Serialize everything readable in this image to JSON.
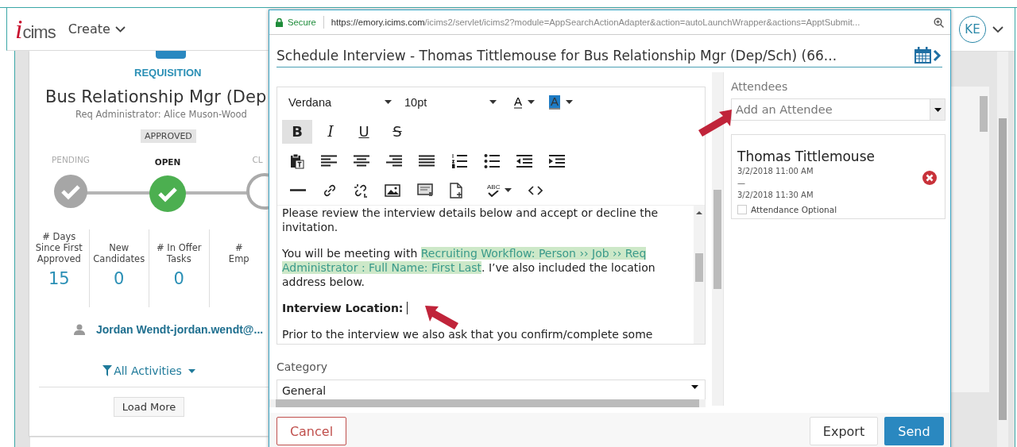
{
  "app_header": {
    "logo_mark": "i",
    "logo_word": "cims",
    "create_menu": "Create",
    "avatar": "KE"
  },
  "requisition": {
    "label": "REQUISITION",
    "title": "Bus Relationship Mgr (Dep",
    "administrator": "Req Administrator: Alice Muson-Wood",
    "status": "APPROVED",
    "stages": [
      {
        "label": "PENDING",
        "kind": "done"
      },
      {
        "label": "OPEN",
        "kind": "current"
      },
      {
        "label": "CL",
        "kind": "upcoming"
      }
    ],
    "stats": [
      {
        "label_lines": [
          "# Days",
          "Since First",
          "Approved"
        ],
        "value": "15"
      },
      {
        "label_lines": [
          "New",
          "Candidates"
        ],
        "value": "0"
      },
      {
        "label_lines": [
          "# In Offer",
          "Tasks"
        ],
        "value": "0"
      },
      {
        "label_lines": [
          "#",
          "Emp"
        ]
      }
    ],
    "contact": "Jordan Wendt-jordan.wendt@...",
    "filter": "All Activities",
    "load_more": "Load More"
  },
  "popup": {
    "address_bar": {
      "secure": "Secure",
      "url_host": "https://emory.icims.com",
      "url_path": "/icims2/servlet/icims2?module=AppSearchActionAdapter&action=autoLaunchWrapper&actions=ApptSubmit..."
    },
    "title": "Schedule Interview - Thomas Tittlemouse for Bus Relationship Mgr (Dep/Sch) (66...",
    "toolbar": {
      "font": "Verdana",
      "size": "10pt",
      "font_color_label": "A",
      "highlight_label": "A",
      "spellcheck_label": "ABC",
      "format_buttons": [
        {
          "label": "B",
          "kind": "bold",
          "selected": true
        },
        {
          "label": "I",
          "kind": "italic",
          "selected": false
        },
        {
          "label": "U",
          "kind": "underline",
          "selected": false
        },
        {
          "label": "S",
          "kind": "strike",
          "selected": false
        }
      ]
    },
    "paragraphs": [
      {
        "bold": false,
        "cursor": false,
        "parts": [
          {
            "text": "Please review the interview details below and accept or decline the invitation.",
            "highlight": false
          }
        ]
      },
      {
        "bold": false,
        "cursor": false,
        "parts": [
          {
            "text": "You will be meeting with ",
            "highlight": false
          },
          {
            "text": "Recruiting Workflow: Person ›› Job ›› Req Administrator : Full Name: First Last",
            "highlight": true
          },
          {
            "text": ". I’ve also included the location address below.",
            "highlight": false
          }
        ]
      },
      {
        "bold": true,
        "cursor": true,
        "parts": [
          {
            "text": "Interview Location:",
            "highlight": false
          }
        ]
      },
      {
        "bold": false,
        "cursor": false,
        "parts": [
          {
            "text": "Prior to the interview we also ask that you confirm/complete some",
            "highlight": false
          }
        ]
      }
    ],
    "category": {
      "label": "Category",
      "value": "General"
    },
    "attendees": {
      "label": "Attendees",
      "placeholder": "Add an Attendee",
      "items": [
        {
          "name": "Thomas Tittlemouse",
          "start": "3/2/2018 11:00 AM",
          "dash": "—",
          "end": "3/2/2018 11:30 AM",
          "optional_label": "Attendance Optional",
          "optional_checked": false
        }
      ]
    },
    "buttons": {
      "cancel": "Cancel",
      "export": "Export",
      "send": "Send"
    }
  }
}
